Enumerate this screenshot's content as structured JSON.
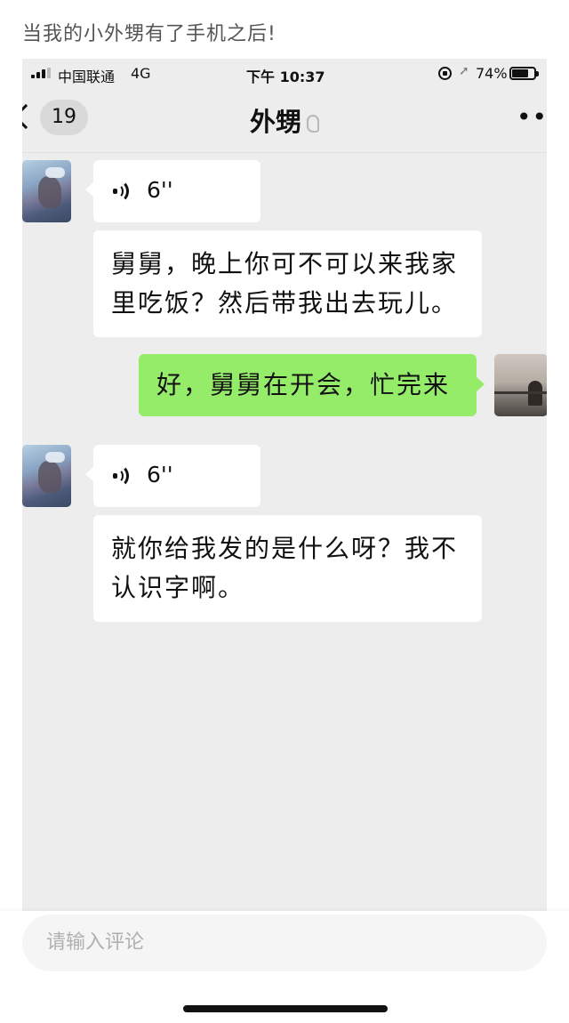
{
  "post": {
    "caption": "当我的小外甥有了手机之后!",
    "comment_placeholder": "请输入评论"
  },
  "status_bar": {
    "carrier": "中国联通",
    "network": "4G",
    "time": "下午 10:37",
    "battery": "74%",
    "battery_level": 0.74
  },
  "chat": {
    "title": "外甥",
    "unread_count": "19",
    "messages": [
      {
        "sender": "外甥",
        "type": "voice",
        "duration": "6''"
      },
      {
        "sender": "外甥",
        "type": "text",
        "text": "舅舅，晚上你可不可以来我家里吃饭？然后带我出去玩儿。"
      },
      {
        "sender": "me",
        "type": "text",
        "text": "好，舅舅在开会，忙完来"
      },
      {
        "sender": "外甥",
        "type": "voice",
        "duration": "6''"
      },
      {
        "sender": "外甥",
        "type": "text",
        "text": "就你给我发的是什么呀？我不认识字啊。"
      }
    ]
  },
  "colors": {
    "outgoing_bubble": "#95ec69",
    "incoming_bubble": "#ffffff",
    "chat_background": "#ededed"
  },
  "icons": [
    "back-chevron-icon",
    "mute-icon",
    "more-icon",
    "voice-icon",
    "signal-icon",
    "lock-icon",
    "location-icon",
    "battery-icon"
  ]
}
